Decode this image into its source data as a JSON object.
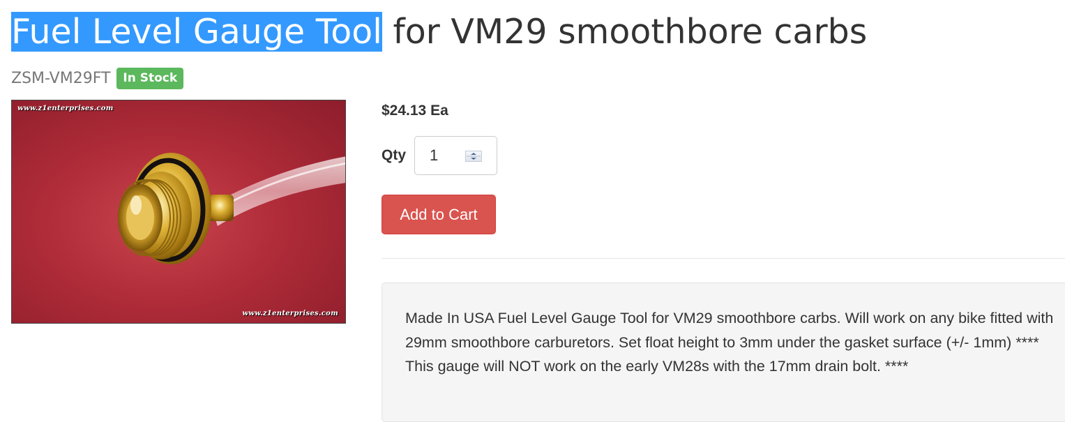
{
  "product": {
    "title_highlighted": "Fuel Level Gauge Tool",
    "title_rest": " for VM29 smoothbore carbs",
    "sku": "ZSM-VM29FT",
    "stock_status": "In Stock",
    "price": "$24.13 Ea",
    "qty_label": "Qty",
    "qty_value": "1",
    "add_to_cart_label": "Add to Cart",
    "description": "Made In USA Fuel Level Gauge Tool for VM29 smoothbore carbs. Will work on any bike fitted with 29mm smoothbore carburetors. Set float height to 3mm under the gasket surface (+/- 1mm) **** This gauge will NOT work on the early VM28s with the 17mm drain bolt. ****"
  },
  "image": {
    "watermark_top": "www.z1enterprises.com",
    "watermark_bottom": "www.z1enterprises.com"
  },
  "colors": {
    "selection_highlight": "#3399ff",
    "badge_success": "#5cb85c",
    "button_danger": "#d9534f",
    "well_background": "#f5f5f5"
  },
  "icons": {
    "spinner": "up-down-spinner-icon"
  }
}
